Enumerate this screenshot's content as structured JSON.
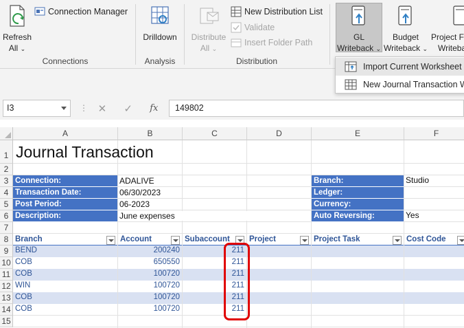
{
  "ribbon": {
    "connections": {
      "refresh_label": "Refresh",
      "refresh_sub": "All",
      "connection_manager_label": "Connection Manager",
      "group_label": "Connections"
    },
    "analysis": {
      "drilldown_label": "Drilldown",
      "group_label": "Analysis"
    },
    "distribution": {
      "distribute_label": "Distribute",
      "distribute_sub": "All",
      "new_list_label": "New Distribution List",
      "validate_label": "Validate",
      "insert_path_label": "Insert Folder Path",
      "group_label": "Distribution"
    },
    "writeback": {
      "gl_label": "GL",
      "gl_sub": "Writeback",
      "budget_label": "Budget",
      "budget_sub": "Writeback",
      "project_label": "Project Fo",
      "project_sub": "Writeba"
    },
    "menu": {
      "items": [
        "Import Current Worksheet",
        "New Journal Transaction Wo"
      ]
    }
  },
  "formula_bar": {
    "name_box": "I3",
    "value": "149802"
  },
  "grid": {
    "columns": [
      "A",
      "B",
      "C",
      "D",
      "E",
      "F"
    ],
    "rows": [
      "1",
      "2",
      "3",
      "4",
      "5",
      "6",
      "7",
      "8",
      "9",
      "10",
      "11",
      "12",
      "13",
      "14",
      "15"
    ],
    "title": "Journal Transaction",
    "header_left": {
      "labels": [
        "Connection:",
        "Transaction Date:",
        "Post Period:",
        "Description:"
      ],
      "values": [
        "ADALIVE",
        "06/30/2023",
        "06-2023",
        "June expenses"
      ]
    },
    "header_right": {
      "labels": [
        "Branch:",
        "Ledger:",
        "Currency:",
        "Auto Reversing:"
      ],
      "values": [
        "Studio",
        "",
        "",
        "Yes"
      ]
    },
    "table_headers": [
      "Branch",
      "Account",
      "Subaccount",
      "Project",
      "Project Task",
      "Cost Code"
    ],
    "table_rows": [
      {
        "branch": "BEND",
        "account": "200240",
        "subaccount": "211"
      },
      {
        "branch": "COB",
        "account": "650550",
        "subaccount": "211"
      },
      {
        "branch": "COB",
        "account": "100720",
        "subaccount": "211"
      },
      {
        "branch": "WIN",
        "account": "100720",
        "subaccount": "211"
      },
      {
        "branch": "COB",
        "account": "100720",
        "subaccount": "211"
      },
      {
        "branch": "COB",
        "account": "100720",
        "subaccount": "211"
      }
    ]
  },
  "colors": {
    "label_fill": "#4472c4",
    "band_fill": "#d9e1f2",
    "highlight_outline": "#e00000"
  }
}
